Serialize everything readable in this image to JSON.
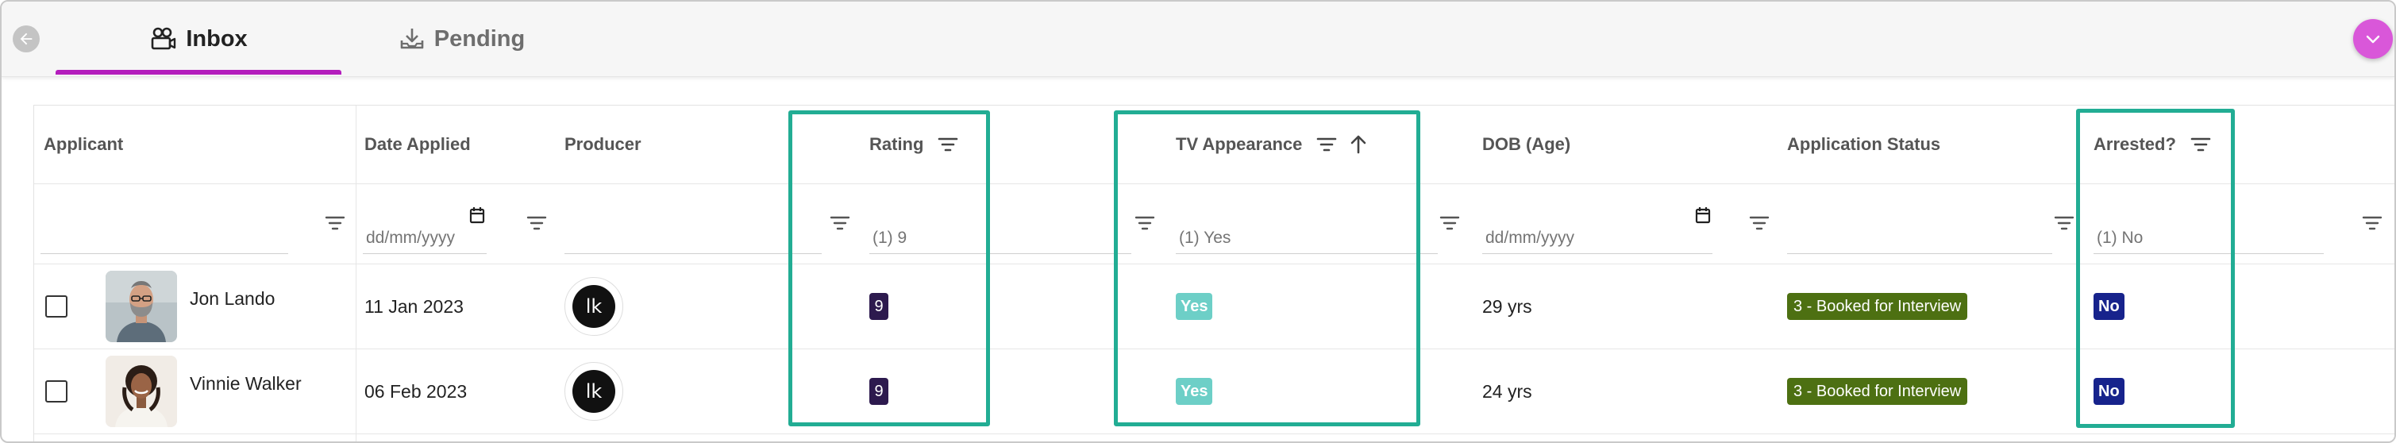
{
  "tabs": {
    "inbox_label": "Inbox",
    "pending_label": "Pending",
    "active": "Inbox"
  },
  "icons": {
    "back": "arrow-left-icon",
    "inbox": "camera-people-icon",
    "pending": "download-tray-icon",
    "fab": "chevron-down-icon",
    "filter": "filter-icon",
    "sort": "arrow-up-icon",
    "calendar": "calendar-icon"
  },
  "colors": {
    "accent": "#b41ebd",
    "fab": "#d957d9",
    "highlight": "#22ad94",
    "rating_chip": "#2d1a4e",
    "tv_chip": "#6dcfc7",
    "status_chip": "#4d7012",
    "arrested_chip": "#17238c"
  },
  "columns": {
    "applicant": "Applicant",
    "date_applied": "Date Applied",
    "producer": "Producer",
    "rating": "Rating",
    "tv_appearance": "TV Appearance",
    "dob": "DOB (Age)",
    "status": "Application Status",
    "arrested": "Arrested?"
  },
  "filters": {
    "applicant": "",
    "date_applied_placeholder": "dd/mm/yyyy",
    "producer": "",
    "rating": "(1) 9",
    "tv_appearance": "(1) Yes",
    "dob_placeholder": "dd/mm/yyyy",
    "status": "",
    "arrested": "(1) No"
  },
  "rows": [
    {
      "name": "Jon Lando",
      "date_applied": "11 Jan 2023",
      "producer_initials": "lk",
      "rating": "9",
      "tv_appearance": "Yes",
      "age": "29 yrs",
      "status": "3 - Booked for Interview",
      "arrested": "No"
    },
    {
      "name": "Vinnie Walker",
      "date_applied": "06 Feb 2023",
      "producer_initials": "lk",
      "rating": "9",
      "tv_appearance": "Yes",
      "age": "24 yrs",
      "status": "3 - Booked for Interview",
      "arrested": "No"
    }
  ]
}
